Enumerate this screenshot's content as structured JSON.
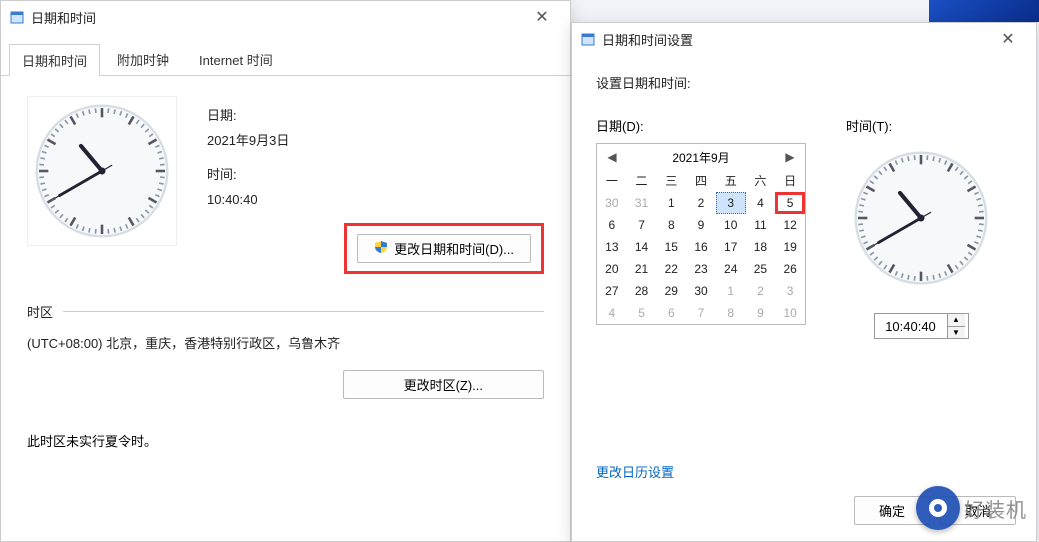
{
  "left": {
    "title": "日期和时间",
    "tabs": [
      "日期和时间",
      "附加时钟",
      "Internet 时间"
    ],
    "date_label": "日期:",
    "date_value": "2021年9月3日",
    "time_label": "时间:",
    "time_value": "10:40:40",
    "change_dt_btn": "更改日期和时间(D)...",
    "tz_header": "时区",
    "tz_value": "(UTC+08:00) 北京，重庆，香港特别行政区，乌鲁木齐",
    "change_tz_btn": "更改时区(Z)...",
    "dst_text": "此时区未实行夏令时。"
  },
  "right": {
    "title": "日期和时间设置",
    "heading": "设置日期和时间:",
    "date_label": "日期(D):",
    "time_label": "时间(T):",
    "cal_title": "2021年9月",
    "dow": [
      "一",
      "二",
      "三",
      "四",
      "五",
      "六",
      "日"
    ],
    "days": [
      {
        "n": "30",
        "other": true
      },
      {
        "n": "31",
        "other": true
      },
      {
        "n": "1"
      },
      {
        "n": "2"
      },
      {
        "n": "3",
        "selected": true
      },
      {
        "n": "4"
      },
      {
        "n": "5",
        "hl": true
      },
      {
        "n": "6"
      },
      {
        "n": "7"
      },
      {
        "n": "8"
      },
      {
        "n": "9"
      },
      {
        "n": "10"
      },
      {
        "n": "11"
      },
      {
        "n": "12"
      },
      {
        "n": "13"
      },
      {
        "n": "14"
      },
      {
        "n": "15"
      },
      {
        "n": "16"
      },
      {
        "n": "17"
      },
      {
        "n": "18"
      },
      {
        "n": "19"
      },
      {
        "n": "20"
      },
      {
        "n": "21"
      },
      {
        "n": "22"
      },
      {
        "n": "23"
      },
      {
        "n": "24"
      },
      {
        "n": "25"
      },
      {
        "n": "26"
      },
      {
        "n": "27"
      },
      {
        "n": "28"
      },
      {
        "n": "29"
      },
      {
        "n": "30"
      },
      {
        "n": "1",
        "other": true
      },
      {
        "n": "2",
        "other": true
      },
      {
        "n": "3",
        "other": true
      },
      {
        "n": "4",
        "other": true
      },
      {
        "n": "5",
        "other": true
      },
      {
        "n": "6",
        "other": true
      },
      {
        "n": "7",
        "other": true
      },
      {
        "n": "8",
        "other": true
      },
      {
        "n": "9",
        "other": true
      },
      {
        "n": "10",
        "other": true
      }
    ],
    "time_value": "10:40:40",
    "link": "更改日历设置",
    "ok": "确定",
    "cancel": "取消"
  },
  "watermark": "好装机",
  "clock": {
    "hour": 10,
    "minute": 40,
    "second": 40
  }
}
